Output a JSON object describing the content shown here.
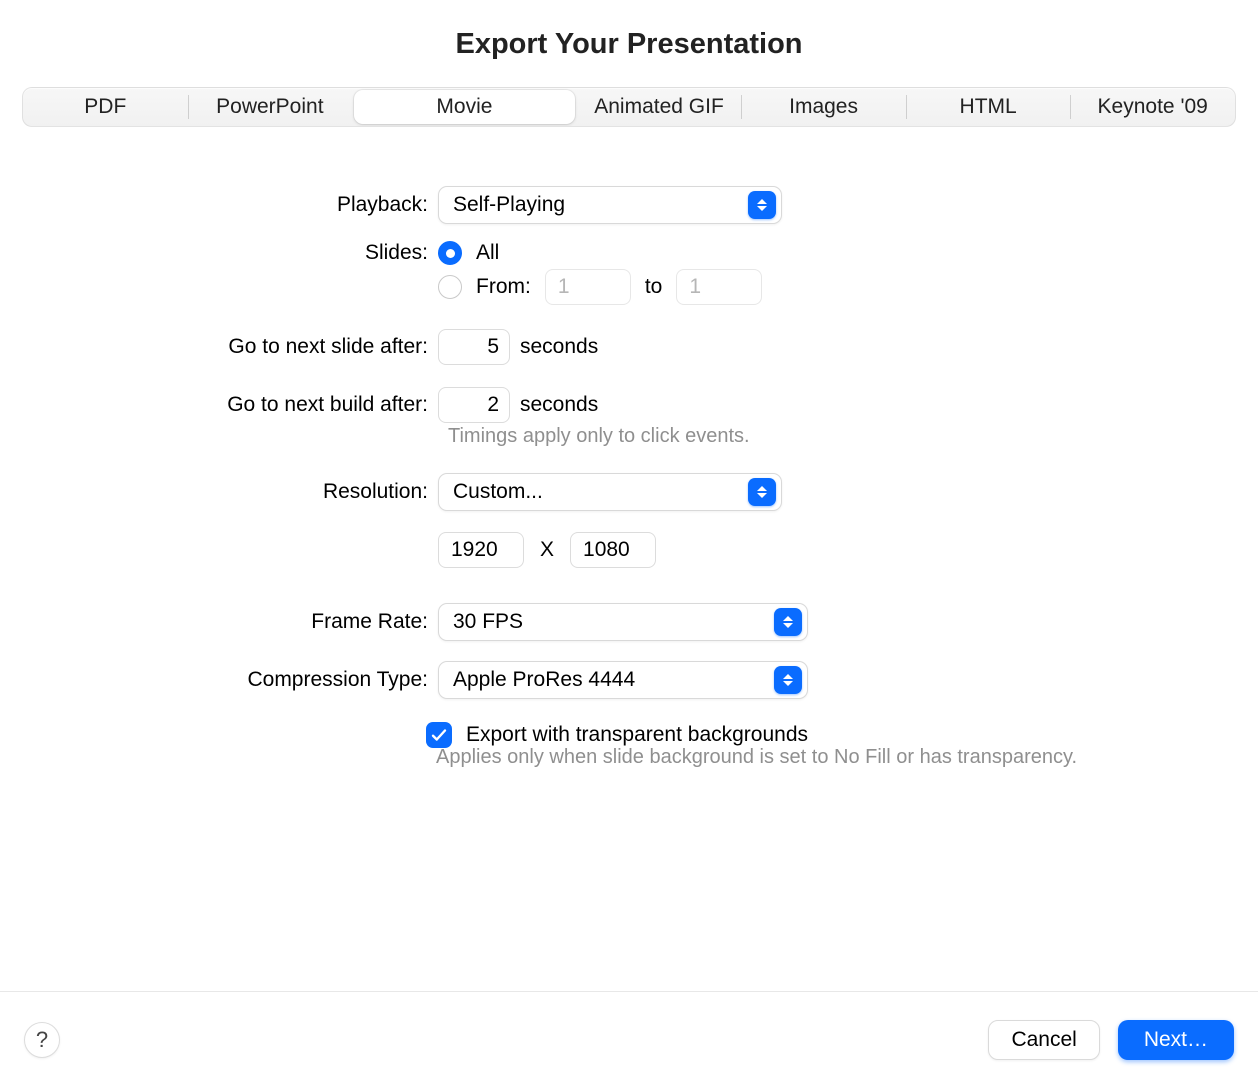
{
  "title": "Export Your Presentation",
  "tabs": [
    "PDF",
    "PowerPoint",
    "Movie",
    "Animated GIF",
    "Images",
    "HTML",
    "Keynote '09"
  ],
  "active_tab": "Movie",
  "labels": {
    "playback": "Playback:",
    "slides": "Slides:",
    "next_slide": "Go to next slide after:",
    "next_build": "Go to next build after:",
    "resolution": "Resolution:",
    "frame_rate": "Frame Rate:",
    "compression": "Compression Type:"
  },
  "playback_value": "Self-Playing",
  "slides": {
    "all_label": "All",
    "from_label": "From:",
    "to_label": "to",
    "from_value": "1",
    "to_value": "1",
    "selected": "all"
  },
  "next_slide_seconds": "5",
  "next_build_seconds": "2",
  "seconds_unit": "seconds",
  "timings_hint": "Timings apply only to click events.",
  "resolution": {
    "preset": "Custom...",
    "width": "1920",
    "height": "1080",
    "sep": "X"
  },
  "frame_rate_value": "30 FPS",
  "compression_value": "Apple ProRes 4444",
  "transparent": {
    "checked": true,
    "label": "Export with transparent backgrounds",
    "hint": "Applies only when slide background is set to No Fill or has transparency."
  },
  "footer": {
    "help": "?",
    "cancel": "Cancel",
    "next": "Next…"
  }
}
